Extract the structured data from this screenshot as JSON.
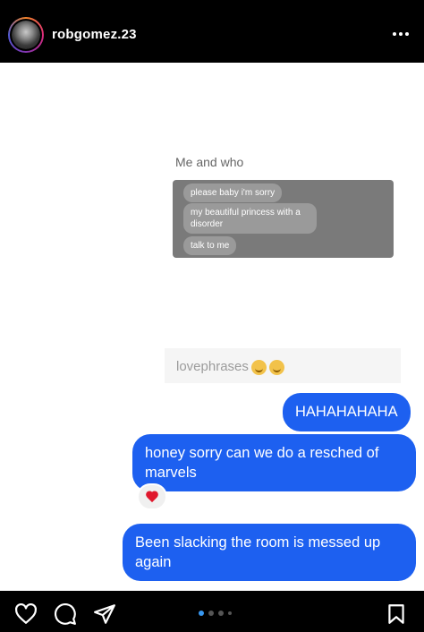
{
  "header": {
    "username": "robgomez.23"
  },
  "screenshot": {
    "title": "Me and who",
    "grey_messages": [
      "please baby i'm sorry",
      "my beautiful princess with a disorder",
      "talk to me"
    ],
    "input_text": "lovephrases"
  },
  "messages": [
    {
      "text": "HAHAHAHAHA"
    },
    {
      "text": "honey sorry can we do a resched of marvels"
    },
    {
      "text": "Been slacking the room is messed up again"
    }
  ],
  "reaction": "heart",
  "colors": {
    "sent_bubble": "#1d60f0",
    "heart": "#e0182d",
    "active_dot": "#3897f0"
  },
  "carousel": {
    "current": 1,
    "total": 4
  }
}
